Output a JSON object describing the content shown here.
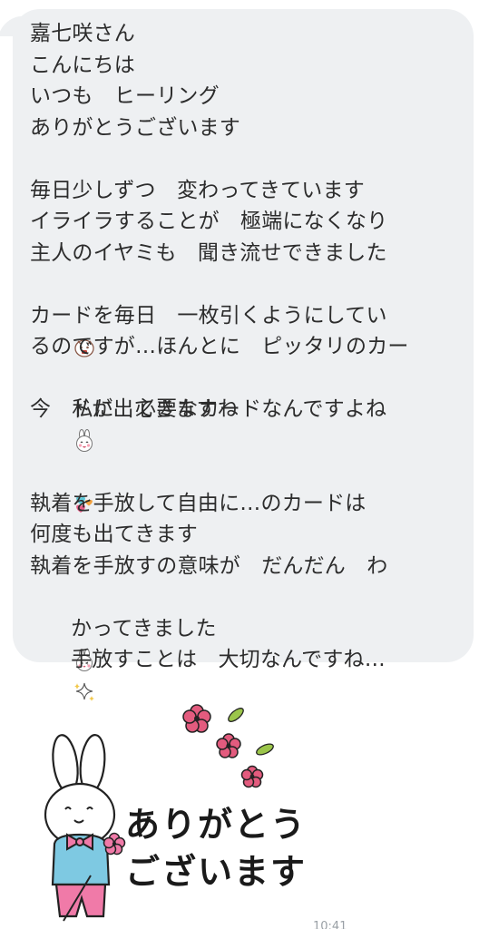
{
  "message": {
    "lines": [
      "嘉七咲さん",
      "こんにちは",
      "いつも　ヒーリング",
      "ありがとうございます",
      "",
      "毎日少しずつ　変わってきています",
      "イライラすることが　極端になくなり",
      "主人のイヤミも　聞き流せできました",
      "",
      "カードを毎日　一枚引くようにしてい",
      "るのですが…ほんとに　ピッタリのカー",
      "ドが出てきますね",
      "今　私に　必要なカードなんですよね",
      "",
      "",
      "執着を手放して自由に…のカードは",
      "何度も出てきます",
      "執着を手放すの意味が　だんだん　わ",
      "かってきました",
      "手放すことは　大切なんですね…"
    ],
    "emoji_icons": {
      "line_8": "angry-face-emoji-icon",
      "line_11": "smiling-bunny-emoji-icon",
      "line_13": "hearts-emoji-icon",
      "line_18": "happy-bunny-emoji-icon",
      "line_19": "sparkles-icon"
    }
  },
  "sticker": {
    "line1": "ありがとう",
    "line2": "ございます",
    "icon": "bunny-thank-you-sticker"
  },
  "timestamp": "10:41",
  "colors": {
    "bubble": "#eef0f2",
    "text": "#2c2c2c",
    "flower": "#e35b7e",
    "leaf": "#9bc54a",
    "shirt": "#7ec9e2",
    "bow": "#f07aa8"
  }
}
